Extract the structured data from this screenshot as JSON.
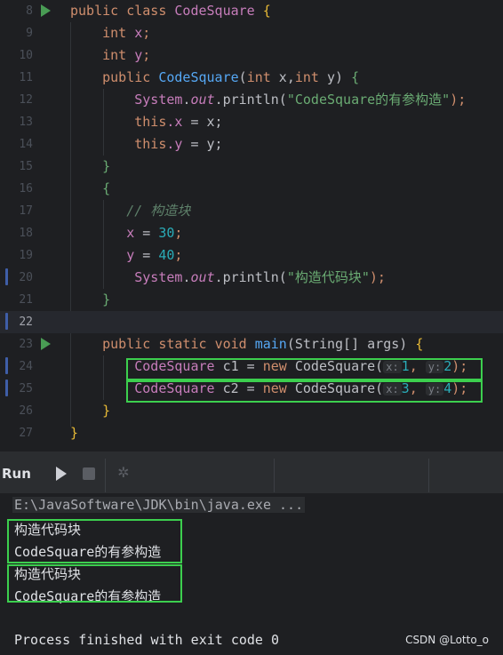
{
  "editor": {
    "lines": [
      {
        "num": "8"
      },
      {
        "num": "9"
      },
      {
        "num": "10"
      },
      {
        "num": "11"
      },
      {
        "num": "12"
      },
      {
        "num": "13"
      },
      {
        "num": "14"
      },
      {
        "num": "15"
      },
      {
        "num": "16"
      },
      {
        "num": "17"
      },
      {
        "num": "18"
      },
      {
        "num": "19"
      },
      {
        "num": "20"
      },
      {
        "num": "21"
      },
      {
        "num": "22"
      },
      {
        "num": "23"
      },
      {
        "num": "24"
      },
      {
        "num": "25"
      },
      {
        "num": "26"
      },
      {
        "num": "27"
      }
    ],
    "t": {
      "public": "public",
      "class": "class",
      "classname": "CodeSquare",
      "int": "int",
      "x_decl": "x",
      "y_decl": "y",
      "semi": ";",
      "ctor_name": "CodeSquare",
      "ctor_params_open": "(",
      "int_kw": "int",
      "x_param": " x,",
      "y_param": " y)",
      "system": "System",
      "dot": ".",
      "out": "out",
      "println": ".println(",
      "str1": "\"CodeSquare的有参构造\"",
      "close_semi": ");",
      "this": "this",
      "x_field": ".x",
      "y_field": ".y",
      "assign_x": " = x;",
      "assign_y": " = y;",
      "open_brace": "{",
      "close_brace": "}",
      "comment": "// 构造块",
      "x_assign": "x",
      "y_assign": "y",
      "eq": " = ",
      "n30": "30",
      "n40": "40",
      "str2": "\"构造代码块\"",
      "static": "static",
      "void": "void",
      "main": "main",
      "string_arr": "(String[] args) ",
      "cs_type": "CodeSquare",
      "c1": " c1 = ",
      "c2": " c2 = ",
      "new": "new",
      "cs_ctor": " CodeSquare(",
      "hint_x": "x:",
      "hint_y": "y:",
      "n1": "1",
      "n2": "2",
      "n3": "3",
      "n4": "4",
      "comma": ", ",
      "end_call": ");"
    }
  },
  "run_panel": {
    "title": "Run"
  },
  "console": {
    "command": "E:\\JavaSoftware\\JDK\\bin\\java.exe ...",
    "output": [
      "构造代码块",
      "CodeSquare的有参构造",
      "构造代码块",
      "CodeSquare的有参构造"
    ],
    "exit": "Process finished with exit code 0"
  },
  "watermark": "CSDN @Lotto_o",
  "colors": {
    "highlight_box": "#3ccf4e",
    "run_arrow": "#499c54"
  }
}
